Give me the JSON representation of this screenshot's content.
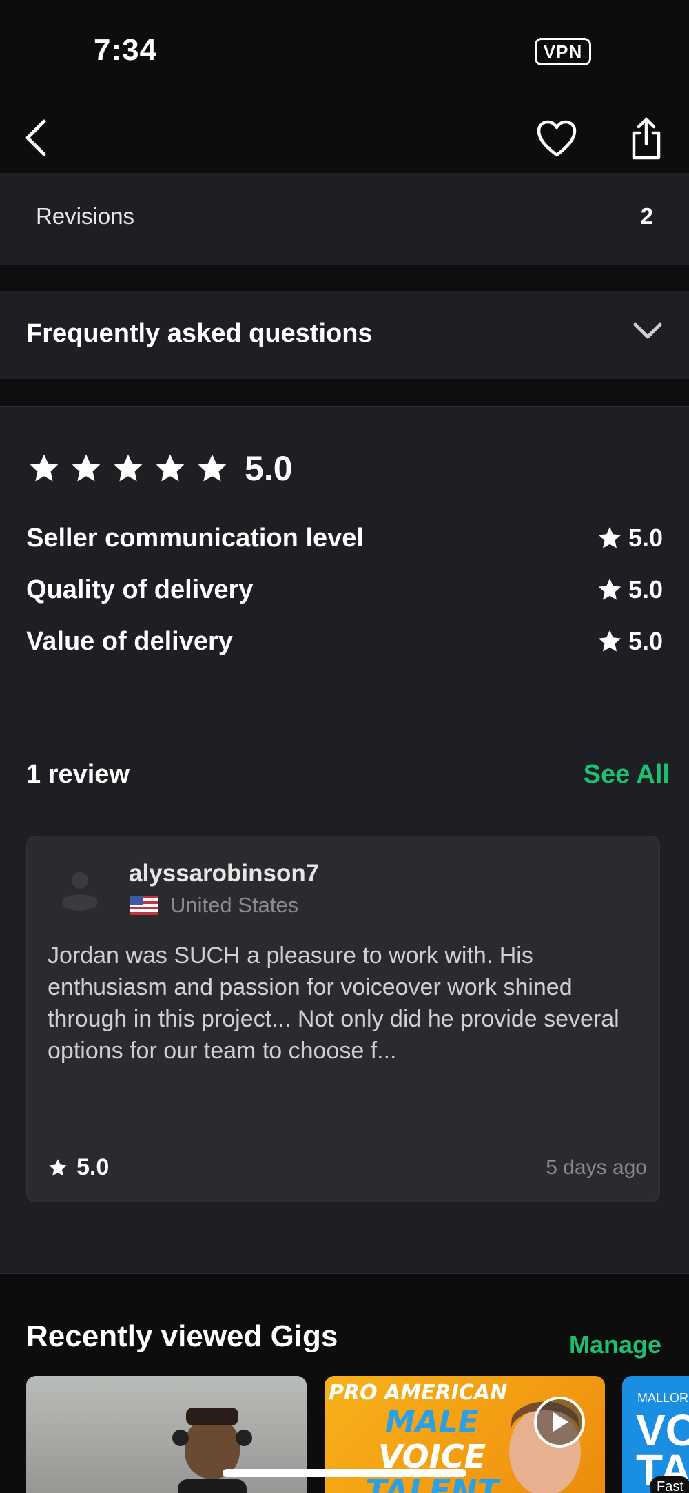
{
  "status_bar": {
    "time": "7:34",
    "vpn": "VPN"
  },
  "nav": {
    "back_icon": "chevron-left-icon",
    "favorite_icon": "heart-icon",
    "share_icon": "share-icon"
  },
  "package": {
    "revisions_label": "Revisions",
    "revisions_value": "2"
  },
  "faq": {
    "title": "Frequently asked questions",
    "icon": "chevron-down-icon"
  },
  "ratings": {
    "overall": "5.0",
    "stars": 5,
    "metrics": [
      {
        "label": "Seller communication level",
        "value": "5.0"
      },
      {
        "label": "Quality of delivery",
        "value": "5.0"
      },
      {
        "label": "Value of delivery",
        "value": "5.0"
      }
    ]
  },
  "reviews": {
    "count_label": "1 review",
    "see_all": "See All",
    "items": [
      {
        "username": "alyssarobinson7",
        "country": "United States",
        "text": "Jordan was SUCH a pleasure to work with. His enthusiasm and passion for voiceover work shined through in this project... Not only did he provide several options for our team to choose f...",
        "score": "5.0",
        "date": "5 days ago"
      }
    ]
  },
  "recent": {
    "title": "Recently viewed Gigs",
    "manage": "Manage",
    "gigs": [
      {
        "text": []
      },
      {
        "text": [
          "PRO AMERICAN",
          "MALE",
          "VOICE",
          "TALENT"
        ]
      },
      {
        "text": [
          "MALLOR",
          "VO",
          "TA",
          "Fast"
        ]
      }
    ]
  },
  "colors": {
    "accent": "#1dbf73",
    "card_bg": "#2a2b2f",
    "section_bg": "#1e1f22",
    "page_bg": "#0d0d0e"
  }
}
